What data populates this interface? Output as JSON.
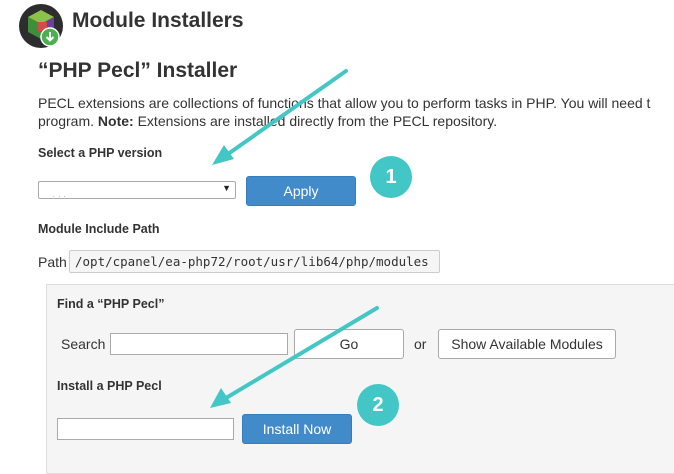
{
  "header": {
    "title": "Module Installers",
    "logo_icon": "cpanel-module-installer-icon"
  },
  "installer": {
    "title": "“PHP Pecl” Installer",
    "description_line1": "PECL extensions are collections of functions that allow you to perform tasks in PHP. You will need t",
    "description_line2_pre": "program. ",
    "note_label": "Note:",
    "description_line2_post": " Extensions are installed directly from the PECL repository."
  },
  "php_version": {
    "label": "Select a PHP version",
    "apply_label": "Apply"
  },
  "module_path": {
    "section_label": "Module Include Path",
    "path_label": "Path",
    "path_value": "/opt/cpanel/ea-php72/root/usr/lib64/php/modules"
  },
  "find": {
    "label": "Find a “PHP Pecl”",
    "search_label": "Search",
    "search_value": "",
    "go_label": "Go",
    "or_label": "or",
    "show_modules_label": "Show Available Modules"
  },
  "install": {
    "label": "Install a PHP Pecl",
    "input_value": "",
    "button_label": "Install Now"
  },
  "annotations": {
    "step1": "1",
    "step2": "2",
    "accent_color": "#43c6c6",
    "button_color": "#428bca"
  }
}
